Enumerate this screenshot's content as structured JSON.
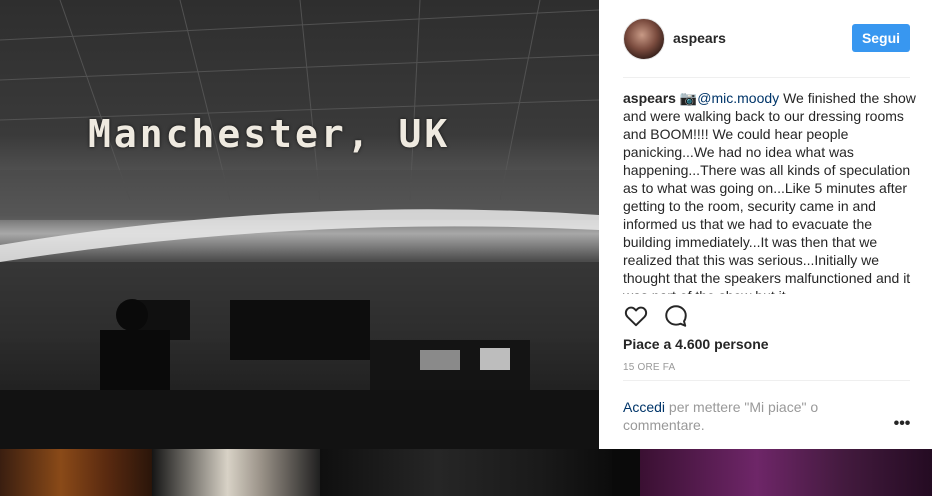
{
  "photo": {
    "caption_text": "Manchester, UK",
    "description_icon": "arena-photo"
  },
  "post": {
    "username": "aspears",
    "follow_label": "Segui",
    "comment": {
      "username": "aspears",
      "camera_icon": "📷",
      "mention": "@mic.moody",
      "text": "We finished the show and were walking back to our dressing rooms and BOOM!!!! We could hear people panicking...We had no idea what was happening...There was all kinds of speculation as to what was going on...Like 5 minutes after getting to the room, security came in and informed us that we had to evacuate the building immediately...It was then that we realized that this was serious...Initially we thought that the speakers malfunctioned and it was part of the show but it"
    },
    "likes": "Piace a 4.600 persone",
    "time_ago": "15 ORE FA",
    "login_link": "Accedi",
    "login_rest": " per mettere \"Mi piace\" o commentare.",
    "more_icon": "ellipsis-icon",
    "more_label": "•••"
  },
  "colors": {
    "follow_button": "#3897f0",
    "link": "#003569",
    "muted": "#999999"
  }
}
